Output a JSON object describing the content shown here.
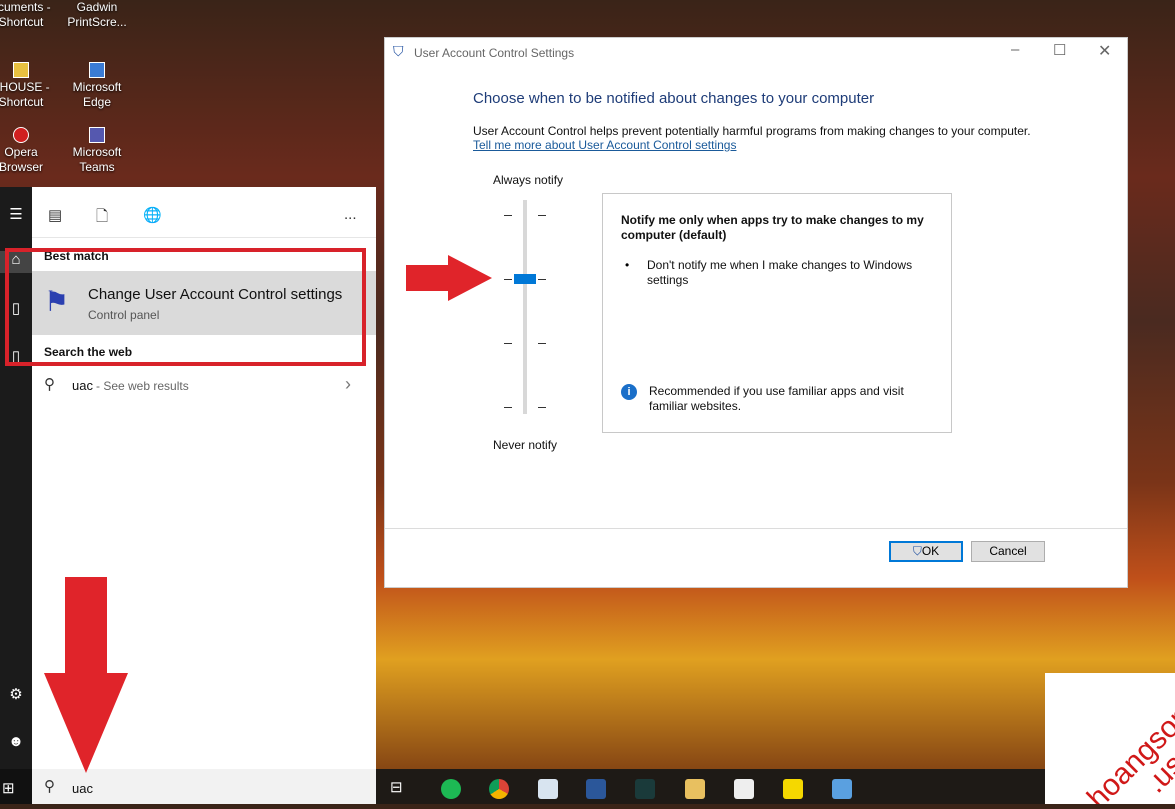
{
  "desktop_icons": [
    {
      "label": "ocuments - Shortcut"
    },
    {
      "label": "Gadwin PrintScre..."
    },
    {
      "label": "I-HOUSE - Shortcut"
    },
    {
      "label": "Microsoft Edge"
    },
    {
      "label": "Opera Browser"
    },
    {
      "label": "Microsoft Teams"
    }
  ],
  "start": {
    "more_label": "...",
    "best_match_label": "Best match",
    "best_match": {
      "title": "Change User Account Control settings",
      "subtitle": "Control panel"
    },
    "search_web_label": "Search the web",
    "web_result": {
      "query": "uac",
      "suffix": " - See web results"
    },
    "search_value": "uac"
  },
  "dialog": {
    "title": "User Account Control Settings",
    "heading": "Choose when to be notified about changes to your computer",
    "description": "User Account Control helps prevent potentially harmful programs from making changes to your computer.",
    "link": "Tell me more about User Account Control settings",
    "slider_top": "Always notify",
    "slider_bottom": "Never notify",
    "slider_level": 3,
    "slider_levels": 4,
    "box_title": "Notify me only when apps try to make changes to my computer (default)",
    "bullet": "Don't notify me when I make changes to Windows settings",
    "recommend": "Recommended if you use familiar apps and visit familiar websites.",
    "ok": "OK",
    "cancel": "Cancel"
  },
  "watermark": "hoangson .us",
  "colors": {
    "accent": "#0078d7",
    "highlight": "#d8222a",
    "heading": "#1e3c78"
  }
}
